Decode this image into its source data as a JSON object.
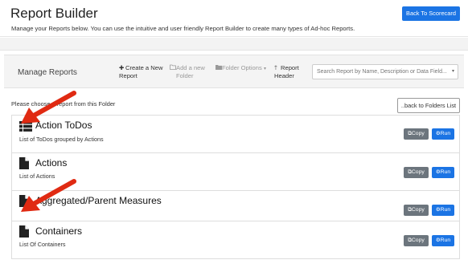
{
  "header": {
    "title": "Report Builder",
    "subtitle": "Manage your Reports below. You can use the intuitive and user friendly Report Builder to create many types of Ad-hoc Reports.",
    "back_scorecard_label": "Back To Scorecard"
  },
  "toolbar": {
    "title": "Manage Reports",
    "new_report": [
      "Create a New",
      "Report"
    ],
    "new_folder": [
      "Add a new",
      "Folder"
    ],
    "folder_options": "Folder Options",
    "report_header": [
      "Report",
      "Header"
    ],
    "search_placeholder": "Search Report by Name, Description or Data Field..."
  },
  "folder": {
    "choose_text": "Please choose a report from this Folder",
    "back_folders_label": "..back to Folders List"
  },
  "reports": [
    {
      "title": "Action ToDos",
      "description": "List of ToDos grouped by Actions",
      "icon": "list-icon"
    },
    {
      "title": "Actions",
      "description": "List of Actions",
      "icon": "file-icon"
    },
    {
      "title": "Aggregated/Parent Measures",
      "description": "",
      "icon": "file-icon"
    },
    {
      "title": "Containers",
      "description": "List Of Containers",
      "icon": "file-icon"
    }
  ],
  "row_buttons": {
    "copy": "Copy",
    "run": "Run"
  },
  "colors": {
    "primary": "#1b74e4",
    "secondary": "#6c757d",
    "annotation_arrow": "#e02a12"
  }
}
